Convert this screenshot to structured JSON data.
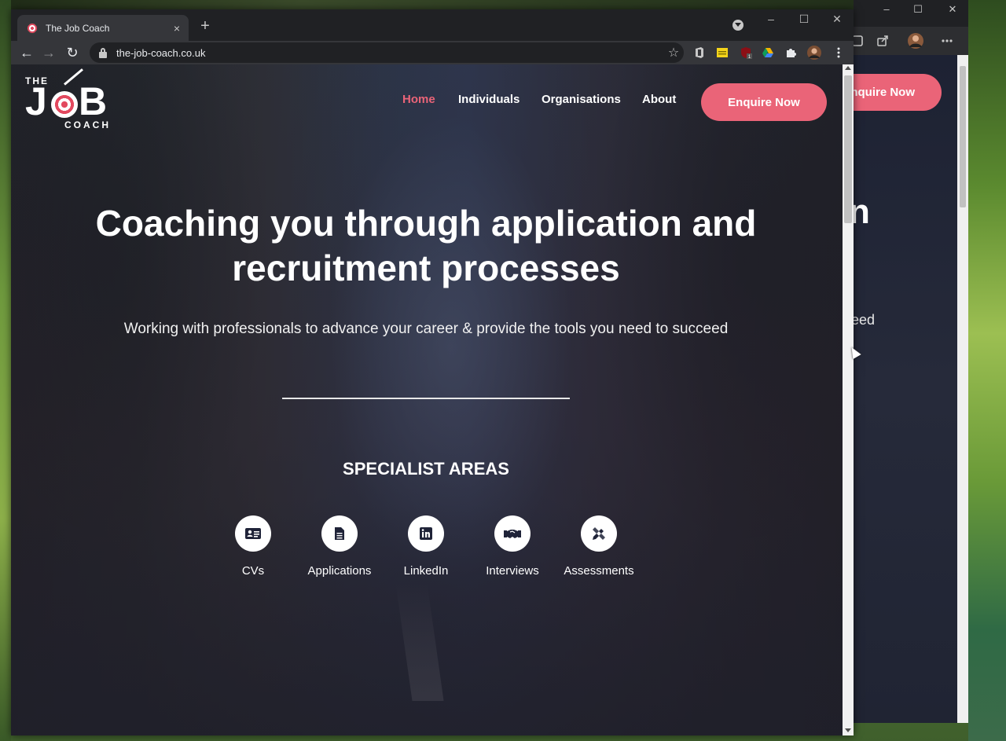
{
  "browser": {
    "tab_title": "The Job Coach",
    "url": "the-job-coach.co.uk",
    "new_tab_glyph": "+",
    "tab_close_glyph": "×"
  },
  "window_controls": {
    "minimize": "–",
    "maximize": "☐",
    "close": "✕"
  },
  "logo": {
    "the": "THE",
    "j": "J",
    "b": "B",
    "coach": "COACH"
  },
  "nav": {
    "items": [
      {
        "label": "Home",
        "active": true
      },
      {
        "label": "Individuals",
        "active": false
      },
      {
        "label": "Organisations",
        "active": false
      },
      {
        "label": "About",
        "active": false
      }
    ],
    "cta": "Enquire Now"
  },
  "hero": {
    "title": "Coaching you through application and recruitment processes",
    "subtitle": "Working with professionals to advance your career & provide the tools you need to succeed"
  },
  "specialist": {
    "heading": "SPECIALIST AREAS",
    "areas": [
      {
        "label": "CVs",
        "icon": "id-card-icon"
      },
      {
        "label": "Applications",
        "icon": "document-icon"
      },
      {
        "label": "LinkedIn",
        "icon": "linkedin-icon"
      },
      {
        "label": "Interviews",
        "icon": "handshake-icon"
      },
      {
        "label": "Assessments",
        "icon": "pencil-ruler-icon"
      }
    ]
  },
  "background_window": {
    "cta_fragment": "nquire Now",
    "heading_fragment": "n",
    "subtitle_fragment": "ceed"
  },
  "colors": {
    "accent": "#ea6478",
    "chrome_dark": "#202124",
    "chrome_toolbar": "#35363a"
  }
}
